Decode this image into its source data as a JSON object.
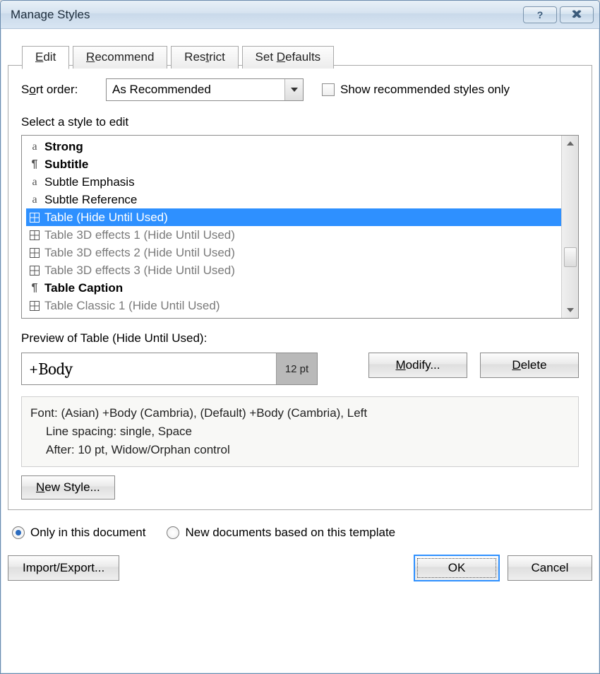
{
  "title": "Manage Styles",
  "tabs": {
    "edit": {
      "label_pre": "",
      "key": "E",
      "label_post": "dit"
    },
    "recommend": {
      "label_pre": "",
      "key": "R",
      "label_post": "ecommend"
    },
    "restrict": {
      "label_pre": "Res",
      "key": "t",
      "label_post": "rict"
    },
    "setdefaults": {
      "label_pre": "Set ",
      "key": "D",
      "label_post": "efaults"
    }
  },
  "sort": {
    "label_pre": "S",
    "label_key": "o",
    "label_post": "rt order:",
    "value": "As Recommended"
  },
  "show_rec_only": "Show recommended styles only",
  "select_label": "Select a style to edit",
  "styles": [
    {
      "icon": "a",
      "name": "Strong",
      "bold": true
    },
    {
      "icon": "para",
      "name": "Subtitle",
      "bold": true
    },
    {
      "icon": "a",
      "name": "Subtle Emphasis",
      "bold": false
    },
    {
      "icon": "a",
      "name": "Subtle Reference",
      "bold": false
    },
    {
      "icon": "grid",
      "name": "Table  (Hide Until Used)",
      "sel": true
    },
    {
      "icon": "grid",
      "name": "Table 3D effects 1  (Hide Until Used)",
      "gray": true
    },
    {
      "icon": "grid",
      "name": "Table 3D effects 2  (Hide Until Used)",
      "gray": true
    },
    {
      "icon": "grid",
      "name": "Table 3D effects 3  (Hide Until Used)",
      "gray": true
    },
    {
      "icon": "para",
      "name": "Table Caption",
      "bold": true
    },
    {
      "icon": "grid",
      "name": "Table Classic 1  (Hide Until Used)",
      "gray": true
    }
  ],
  "preview": {
    "label": "Preview of Table  (Hide Until Used):",
    "font": "+Body",
    "pt": "12 pt",
    "modify_pre": "",
    "modify_key": "M",
    "modify_post": "odify...",
    "delete_pre": "",
    "delete_key": "D",
    "delete_post": "elete"
  },
  "desc": {
    "l1": "Font: (Asian) +Body (Cambria), (Default) +Body (Cambria), Left",
    "l2": "Line spacing:  single, Space",
    "l3": "After:  10 pt, Widow/Orphan control"
  },
  "newstyle_pre": "",
  "newstyle_key": "N",
  "newstyle_post": "ew Style...",
  "radio": {
    "only": "Only in this document",
    "template": "New documents based on this template"
  },
  "buttons": {
    "import": "Import/Export...",
    "ok": "OK",
    "cancel": "Cancel"
  }
}
